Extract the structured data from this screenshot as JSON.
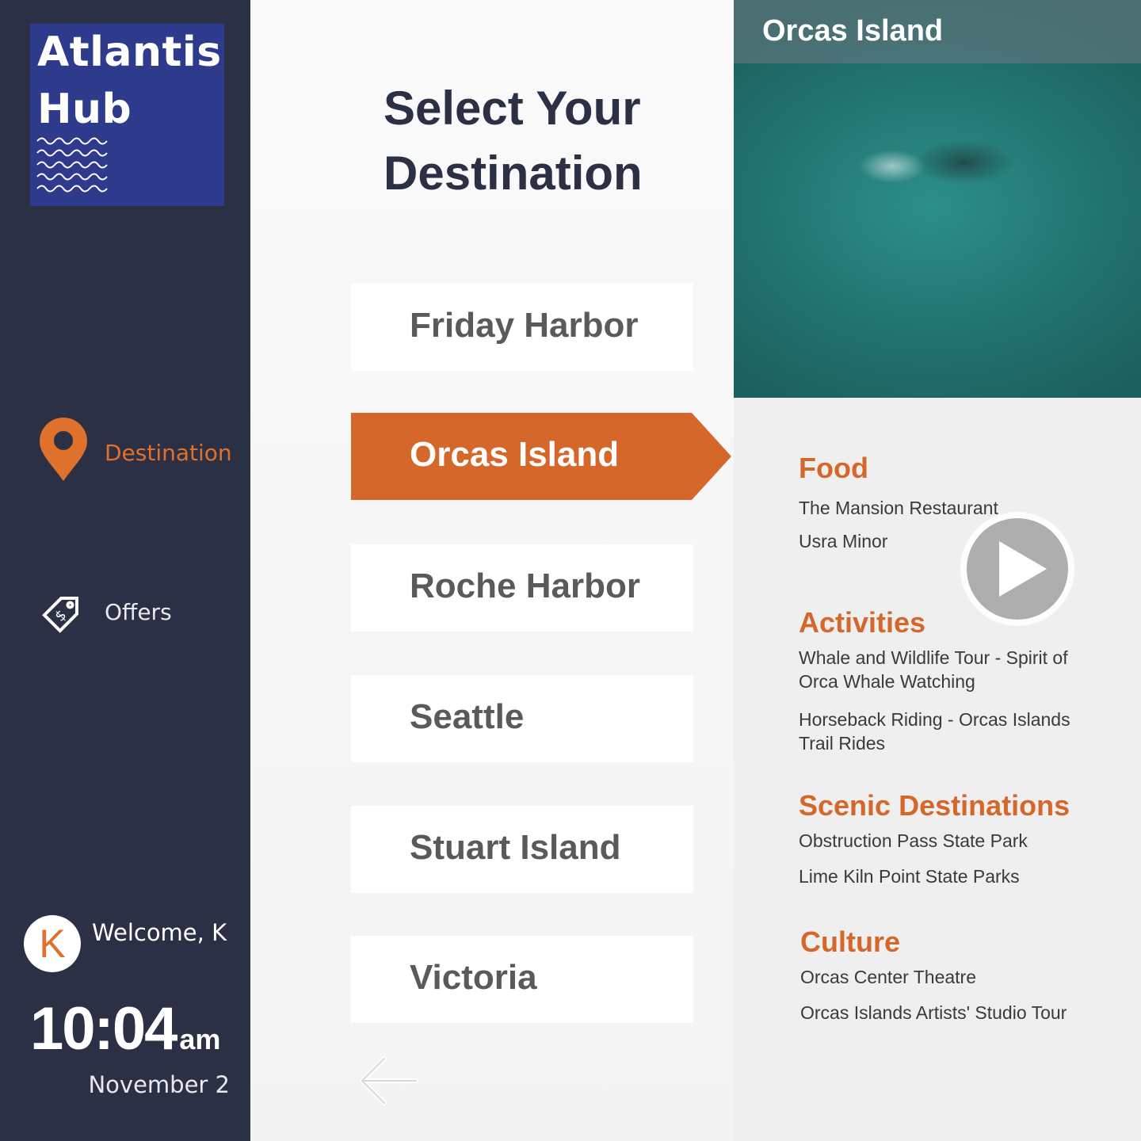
{
  "app": {
    "logo_line1": "Atlantis",
    "logo_line2": "Hub"
  },
  "sidebar": {
    "nav": [
      {
        "label": "Destination",
        "icon": "location-pin-icon",
        "active": true
      },
      {
        "label": "Offers",
        "icon": "price-tag-icon",
        "active": false
      }
    ],
    "user": {
      "avatar_initial": "K",
      "welcome": "Welcome, K"
    },
    "clock": {
      "time": "10:04",
      "ampm": "am",
      "date": "November 2"
    }
  },
  "main": {
    "title_line1": "Select Your",
    "title_line2": "Destination",
    "destinations": [
      "Friday Harbor",
      "Orcas Island",
      "Roche Harbor",
      "Seattle",
      "Stuart Island",
      "Victoria"
    ],
    "selected": "Orcas Island",
    "back_icon": "arrow-left-icon"
  },
  "detail": {
    "photo_title": "Orcas Island",
    "play_icon": "play-icon",
    "sections": [
      {
        "title": "Food",
        "items": [
          "The Mansion Restaurant",
          "Usra Minor"
        ]
      },
      {
        "title": "Activities",
        "items": [
          "Whale and Wildlife Tour - Spirit of Orca Whale Watching",
          "Horseback Riding - Orcas Islands Trail Rides"
        ]
      },
      {
        "title": "Scenic Destinations",
        "items": [
          "Obstruction Pass State Park",
          "Lime Kiln Point State Parks"
        ]
      },
      {
        "title": "Culture",
        "items": [
          "Orcas Center Theatre",
          "Orcas Islands Artists' Studio Tour"
        ]
      }
    ]
  },
  "colors": {
    "sidebar_bg": "#2b3045",
    "logo_bg": "#2e3a8c",
    "accent": "#d5672b",
    "title_text": "#2b3045"
  }
}
